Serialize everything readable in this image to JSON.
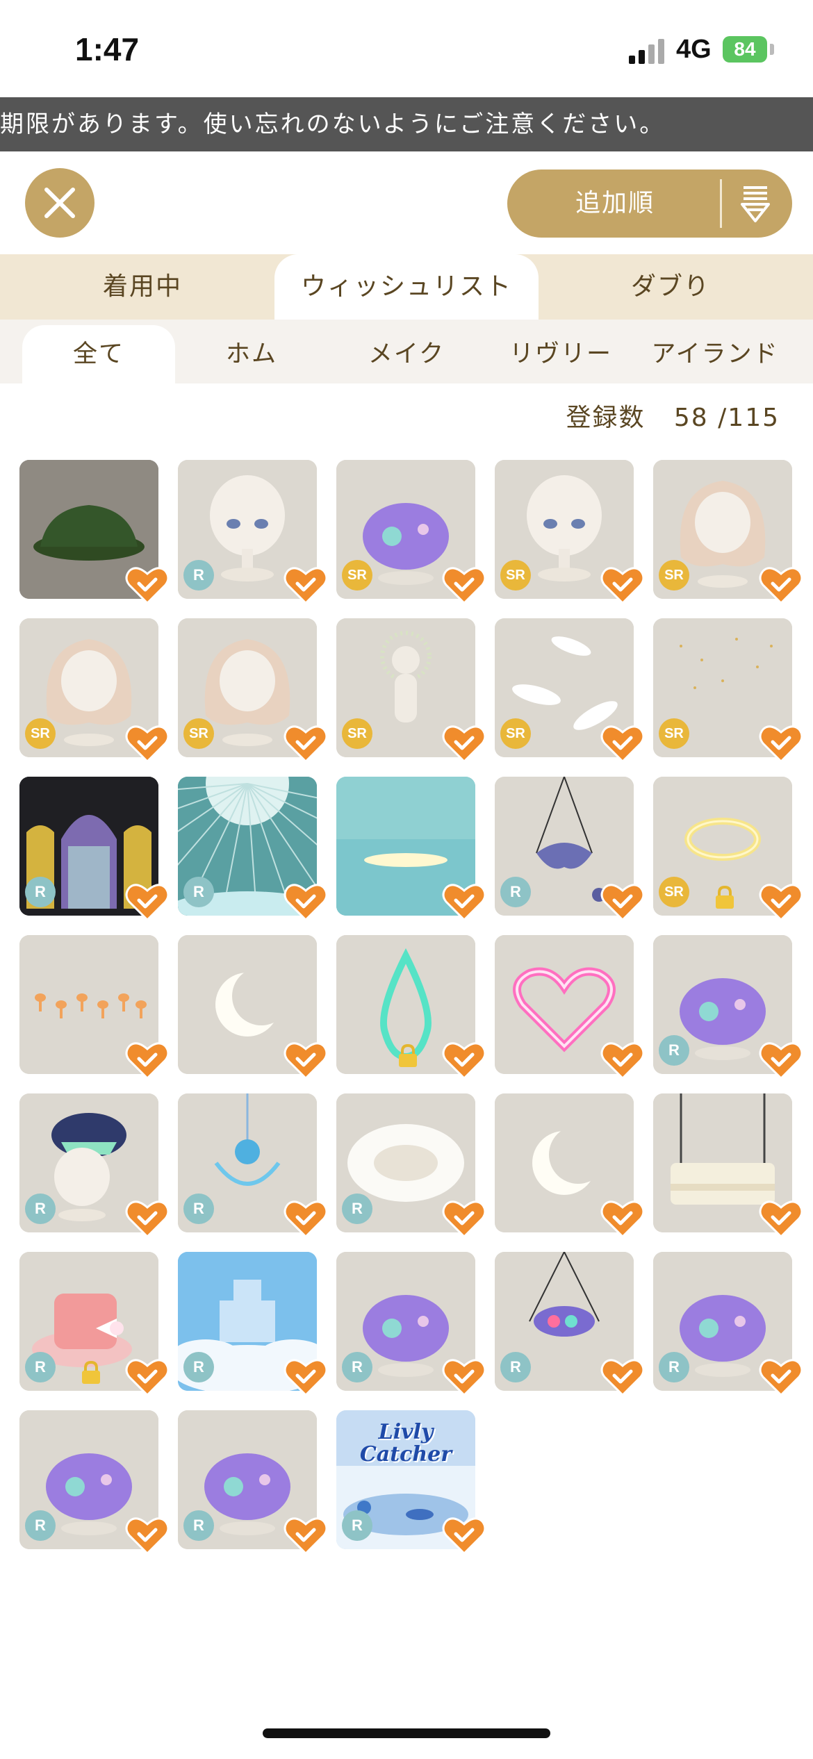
{
  "status": {
    "time": "1:47",
    "network": "4G",
    "battery": "84"
  },
  "banner": {
    "text": "期限があります。使い忘れのないようにご注意ください。"
  },
  "header": {
    "sort_label": "追加順"
  },
  "tabs": [
    {
      "label": "着用中"
    },
    {
      "label": "ウィッシュリスト",
      "active": true
    },
    {
      "label": "ダブり"
    }
  ],
  "subtabs": [
    {
      "label": "全て",
      "active": true
    },
    {
      "label": "ホム"
    },
    {
      "label": "メイク"
    },
    {
      "label": "リヴリー"
    },
    {
      "label": "アイランド"
    }
  ],
  "registration": {
    "label": "登録数",
    "value": "58 /115"
  },
  "items": [
    {
      "name": "green-hat",
      "rarity": "",
      "locked": false,
      "favorite": true,
      "bg": "#8f8a82",
      "icon": "hat-icon"
    },
    {
      "name": "blue-eyes",
      "rarity": "R",
      "locked": false,
      "favorite": true,
      "bg": "#dcd8d0",
      "icon": "eyes-icon"
    },
    {
      "name": "patchwork-plush",
      "rarity": "SR",
      "locked": false,
      "favorite": true,
      "bg": "#dcd8d0",
      "icon": "plush-icon"
    },
    {
      "name": "brown-eyes",
      "rarity": "SR",
      "locked": false,
      "favorite": true,
      "bg": "#dcd8d0",
      "icon": "eyes-icon"
    },
    {
      "name": "long-hair",
      "rarity": "SR",
      "locked": false,
      "favorite": true,
      "bg": "#dcd8d0",
      "icon": "hair-icon"
    },
    {
      "name": "lavender-hair",
      "rarity": "SR",
      "locked": false,
      "favorite": true,
      "bg": "#dcd8d0",
      "icon": "hair-icon"
    },
    {
      "name": "flower-hair",
      "rarity": "SR",
      "locked": false,
      "favorite": true,
      "bg": "#dcd8d0",
      "icon": "hair-icon"
    },
    {
      "name": "halo-body",
      "rarity": "SR",
      "locked": false,
      "favorite": true,
      "bg": "#dcd8d0",
      "icon": "body-icon"
    },
    {
      "name": "feathers",
      "rarity": "SR",
      "locked": false,
      "favorite": true,
      "bg": "#dcd8d0",
      "icon": "feather-icon"
    },
    {
      "name": "gold-sparkle",
      "rarity": "SR",
      "locked": false,
      "favorite": true,
      "bg": "#dcd8d0",
      "icon": "sparkle-icon"
    },
    {
      "name": "stained-glass",
      "rarity": "R",
      "locked": false,
      "favorite": true,
      "bg": "#1f1f23",
      "icon": "window-icon"
    },
    {
      "name": "moon-sky",
      "rarity": "R",
      "locked": false,
      "favorite": true,
      "bg": "#5aa0a2",
      "icon": "moon-icon"
    },
    {
      "name": "sea",
      "rarity": "",
      "locked": false,
      "favorite": true,
      "bg": "#8fd0d2",
      "icon": "sea-icon"
    },
    {
      "name": "bat-mobile",
      "rarity": "R",
      "locked": false,
      "favorite": true,
      "bg": "#dcd8d0",
      "icon": "bat-icon"
    },
    {
      "name": "halo",
      "rarity": "SR",
      "locked": true,
      "favorite": true,
      "bg": "#dcd8d0",
      "icon": "halo-icon"
    },
    {
      "name": "mushrooms",
      "rarity": "",
      "locked": false,
      "favorite": true,
      "bg": "#dcd8d0",
      "icon": "mushroom-icon"
    },
    {
      "name": "crescent-moon",
      "rarity": "",
      "locked": false,
      "favorite": true,
      "bg": "#dcd8d0",
      "icon": "crescent-icon"
    },
    {
      "name": "neon-drop",
      "rarity": "",
      "locked": true,
      "favorite": true,
      "bg": "#dcd8d0",
      "icon": "drop-icon"
    },
    {
      "name": "neon-heart",
      "rarity": "",
      "locked": false,
      "favorite": true,
      "bg": "#dcd8d0",
      "icon": "heart-icon"
    },
    {
      "name": "pink-plush-hat",
      "rarity": "R",
      "locked": false,
      "favorite": true,
      "bg": "#dcd8d0",
      "icon": "plush-icon"
    },
    {
      "name": "shark-hat",
      "rarity": "R",
      "locked": false,
      "favorite": true,
      "bg": "#dcd8d0",
      "icon": "shark-icon"
    },
    {
      "name": "bear-necklace",
      "rarity": "R",
      "locked": false,
      "favorite": true,
      "bg": "#dcd8d0",
      "icon": "necklace-icon"
    },
    {
      "name": "fur-nest",
      "rarity": "R",
      "locked": false,
      "favorite": true,
      "bg": "#dcd8d0",
      "icon": "nest-icon"
    },
    {
      "name": "moon-cushion",
      "rarity": "",
      "locked": false,
      "favorite": true,
      "bg": "#dcd8d0",
      "icon": "crescent-icon"
    },
    {
      "name": "swing-bench",
      "rarity": "",
      "locked": false,
      "favorite": true,
      "bg": "#dcd8d0",
      "icon": "swing-icon"
    },
    {
      "name": "pink-top-hat",
      "rarity": "R",
      "locked": true,
      "favorite": true,
      "bg": "#dcd8d0",
      "icon": "hat-icon"
    },
    {
      "name": "sky-castle",
      "rarity": "R",
      "locked": false,
      "favorite": true,
      "bg": "#7cc0ec",
      "icon": "castle-icon"
    },
    {
      "name": "green-plush",
      "rarity": "R",
      "locked": false,
      "favorite": true,
      "bg": "#dcd8d0",
      "icon": "plush-icon"
    },
    {
      "name": "plush-mobile",
      "rarity": "R",
      "locked": false,
      "favorite": true,
      "bg": "#dcd8d0",
      "icon": "mobile-icon"
    },
    {
      "name": "purple-plush",
      "rarity": "R",
      "locked": false,
      "favorite": true,
      "bg": "#dcd8d0",
      "icon": "plush-icon"
    },
    {
      "name": "pink-dragon-plush",
      "rarity": "R",
      "locked": false,
      "favorite": true,
      "bg": "#dcd8d0",
      "icon": "plush-icon"
    },
    {
      "name": "purple-bunny-plush",
      "rarity": "R",
      "locked": false,
      "favorite": true,
      "bg": "#dcd8d0",
      "icon": "plush-icon"
    },
    {
      "name": "livly-catcher",
      "rarity": "R",
      "locked": false,
      "favorite": true,
      "bg": "#cfe3f5",
      "icon": "catcher-icon",
      "logo_text": "Livly Catcher"
    }
  ],
  "colors": {
    "gold": "#c4a566",
    "favorite": "#f08c2c",
    "rarity_r": "#8ec3c6",
    "rarity_sr": "#e9b73a"
  }
}
